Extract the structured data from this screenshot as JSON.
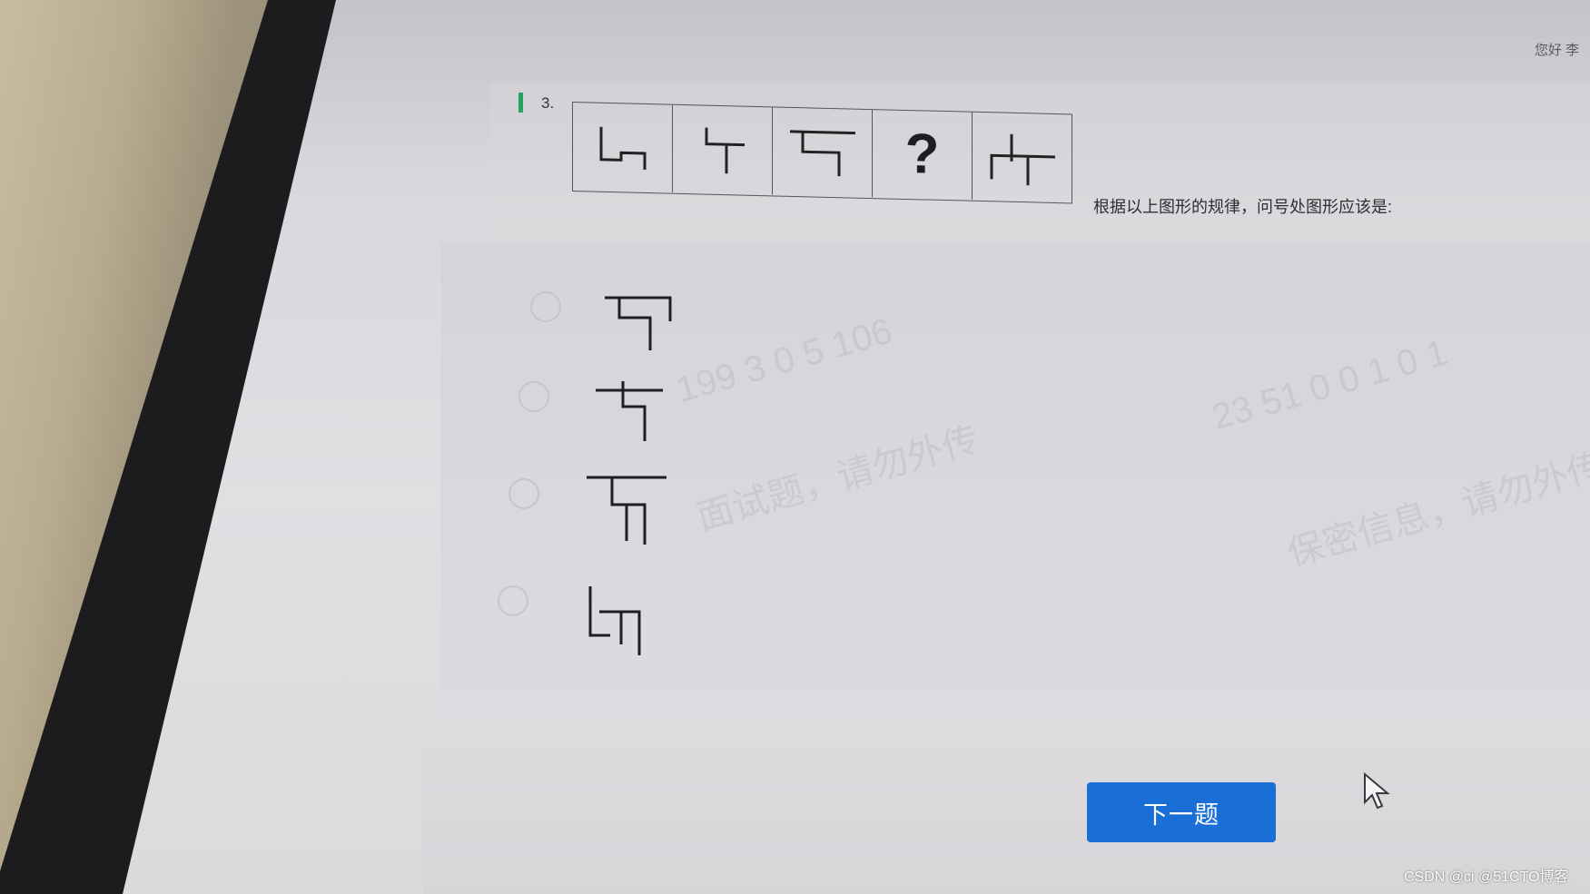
{
  "header": {
    "greeting": "您好 李"
  },
  "question": {
    "number": "3.",
    "sequence": [
      {
        "kind": "figure",
        "icon": "figure-1-icon"
      },
      {
        "kind": "figure",
        "icon": "figure-2-icon"
      },
      {
        "kind": "figure",
        "icon": "figure-3-icon"
      },
      {
        "kind": "unknown",
        "text": "?"
      },
      {
        "kind": "figure",
        "icon": "figure-5-icon"
      }
    ],
    "instruction": "根据以上图形的规律，问号处图形应该是:"
  },
  "options": [
    {
      "icon": "option-a-glyph-icon",
      "selected": false
    },
    {
      "icon": "option-b-glyph-icon",
      "selected": false
    },
    {
      "icon": "option-c-glyph-icon",
      "selected": false
    },
    {
      "icon": "option-d-glyph-icon",
      "selected": false
    }
  ],
  "watermarks": [
    "199 3 0 5 106",
    "23 51 0 0 1 0 1",
    "面试题，请勿外传",
    "保密信息，请勿外传"
  ],
  "actions": {
    "next_label": "下一题"
  },
  "footer": {
    "credit": "CSDN @ci  @51CTO博客"
  },
  "colors": {
    "accent": "#1a6fd6",
    "question_bar": "#24a364"
  }
}
